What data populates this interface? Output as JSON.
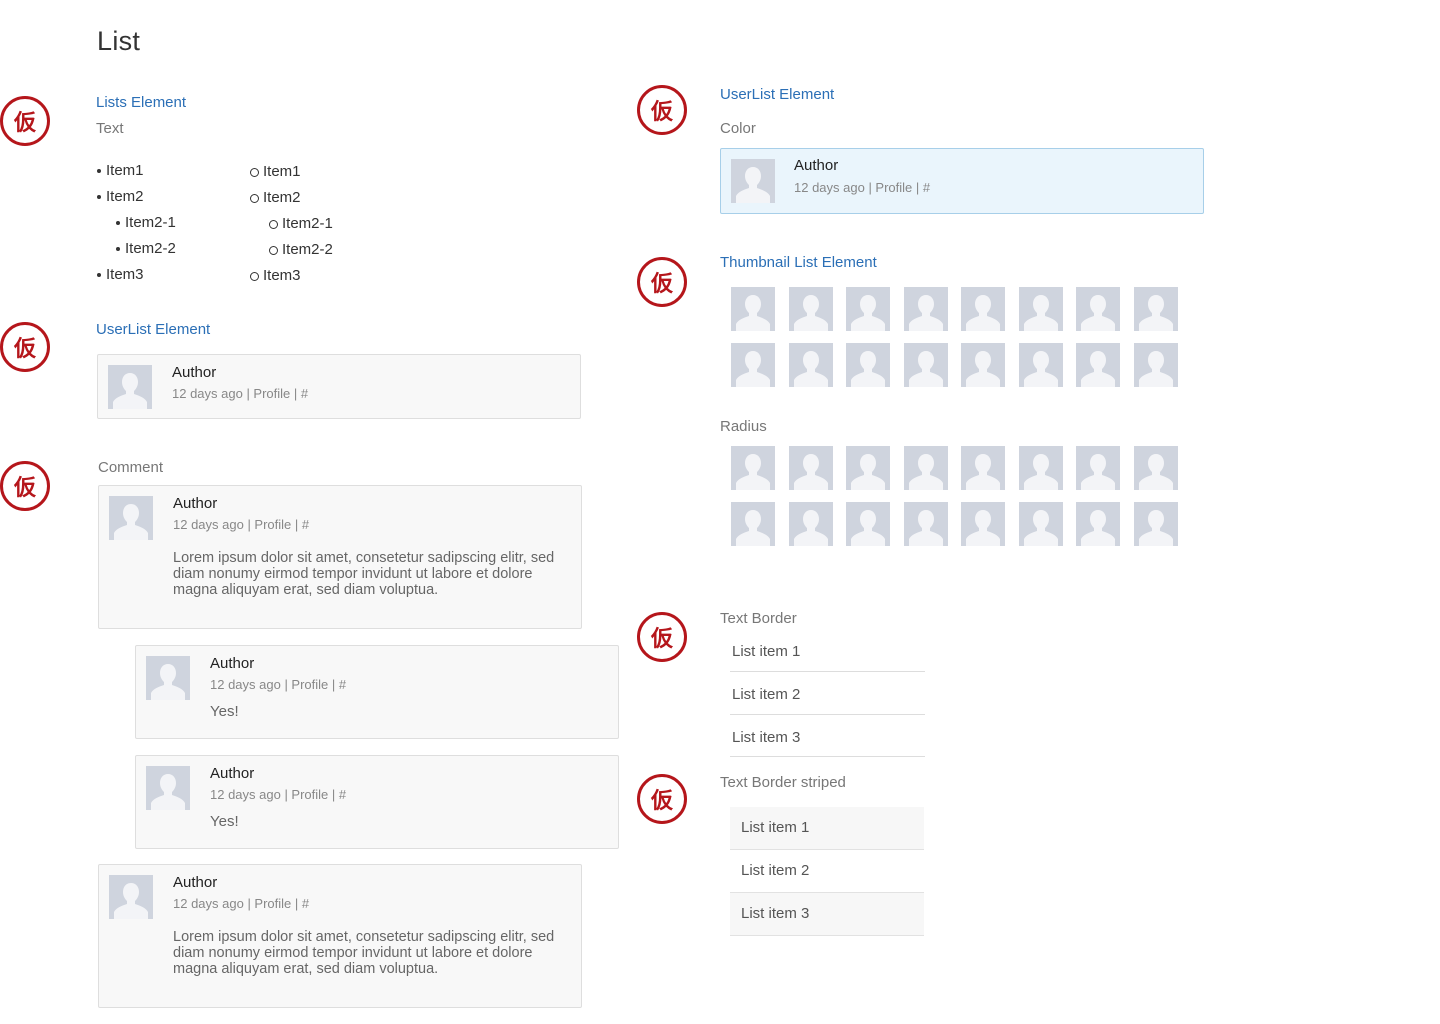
{
  "page": {
    "title": "List"
  },
  "stamp_char": "仮",
  "lists": {
    "title": "Lists Element",
    "label": "Text",
    "bullet_items": [
      "Item1",
      "Item2",
      "Item2-1",
      "Item2-2",
      "Item3"
    ],
    "circle_items": [
      "Item1",
      "Item2",
      "Item2-1",
      "Item2-2",
      "Item3"
    ]
  },
  "userlist": {
    "title": "UserList Element",
    "author": "Author",
    "meta": "12 days ago | Profile | #"
  },
  "comment": {
    "label": "Comment",
    "author": "Author",
    "meta": "12 days ago | Profile | #",
    "lorem": "Lorem ipsum dolor sit amet, consetetur sadipscing elitr, sed diam nonumy eirmod tempor invidunt ut labore et dolore magna aliquyam erat, sed diam voluptua.",
    "reply": "Yes!"
  },
  "userlist_color": {
    "title": "UserList Element",
    "label": "Color",
    "author": "Author",
    "meta": "12 days ago | Profile | #"
  },
  "thumbnail": {
    "title": "Thumbnail List Element",
    "radius_label": "Radius"
  },
  "text_border": {
    "label": "Text Border",
    "items": [
      "List item 1",
      "List item 2",
      "List item 3"
    ]
  },
  "text_border_striped": {
    "label": "Text Border striped",
    "items": [
      "List item 1",
      "List item 2",
      "List item 3"
    ]
  },
  "colors": {
    "accent": "#2b6fb6",
    "stamp": "#b5161b",
    "avatar_bg": "#cfd4de",
    "card_bg": "#f8f8f8",
    "card_blue_bg": "#eaf5fc"
  }
}
